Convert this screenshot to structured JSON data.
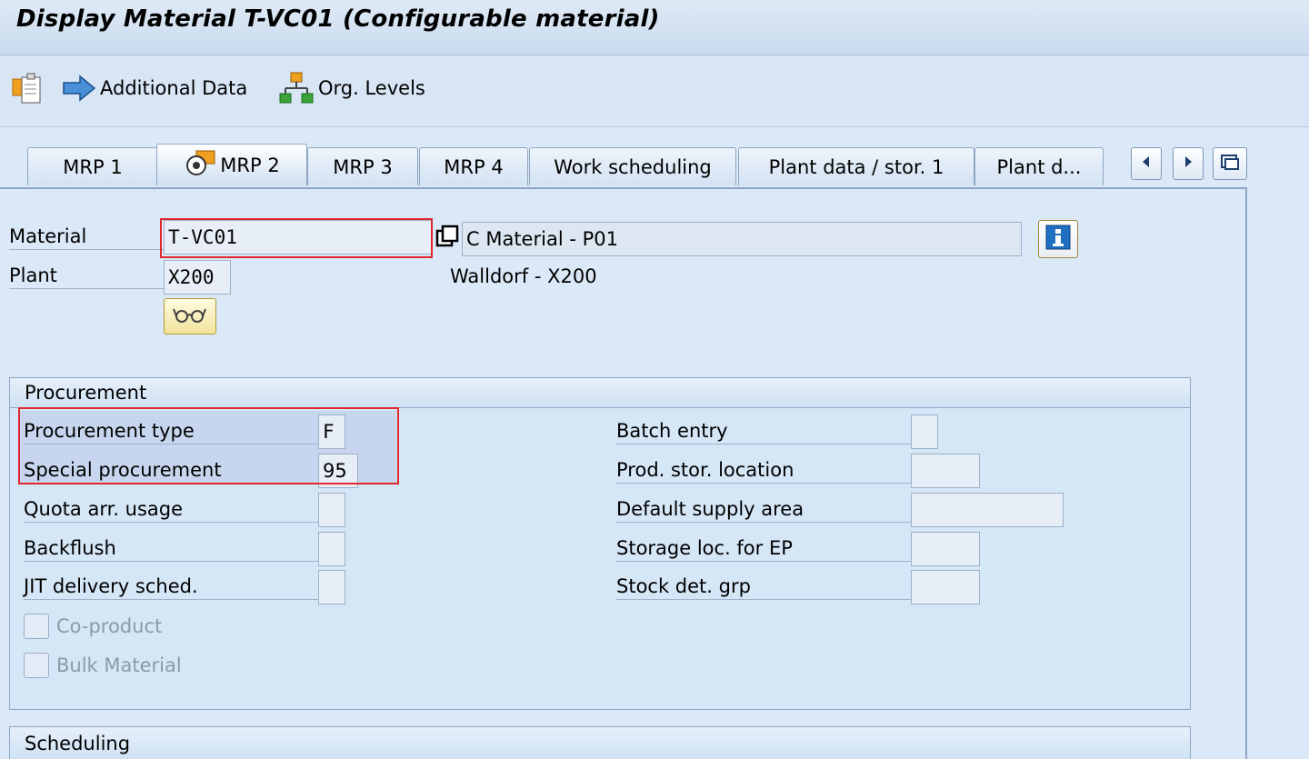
{
  "window": {
    "title": "Display Material T-VC01 (Configurable material)"
  },
  "toolbar": {
    "additional_data_label": "Additional Data",
    "org_levels_label": "Org. Levels"
  },
  "tabs": [
    {
      "label": "MRP 1"
    },
    {
      "label": "MRP 2"
    },
    {
      "label": "MRP 3"
    },
    {
      "label": "MRP 4"
    },
    {
      "label": "Work scheduling"
    },
    {
      "label": "Plant data / stor. 1"
    },
    {
      "label": "Plant d..."
    }
  ],
  "header": {
    "material_label": "Material",
    "material_value": "T-VC01",
    "material_desc": "C Material  - P01",
    "plant_label": "Plant",
    "plant_value": "X200",
    "plant_desc": "Walldorf - X200"
  },
  "procurement": {
    "title": "Procurement",
    "left": [
      {
        "label": "Procurement type",
        "value": "F"
      },
      {
        "label": "Special procurement",
        "value": "95"
      },
      {
        "label": "Quota arr. usage",
        "value": ""
      },
      {
        "label": "Backflush",
        "value": ""
      },
      {
        "label": "JIT delivery sched.",
        "value": ""
      }
    ],
    "right": [
      {
        "label": "Batch entry",
        "value": ""
      },
      {
        "label": "Prod. stor. location",
        "value": ""
      },
      {
        "label": "Default supply area",
        "value": ""
      },
      {
        "label": "Storage loc. for EP",
        "value": ""
      },
      {
        "label": "Stock det. grp",
        "value": ""
      }
    ],
    "co_product_label": "Co-product",
    "bulk_material_label": "Bulk Material"
  },
  "scheduling": {
    "title": "Scheduling"
  },
  "colors": {
    "highlight_border": "#e0282d",
    "accent": "#1e6fc0"
  }
}
